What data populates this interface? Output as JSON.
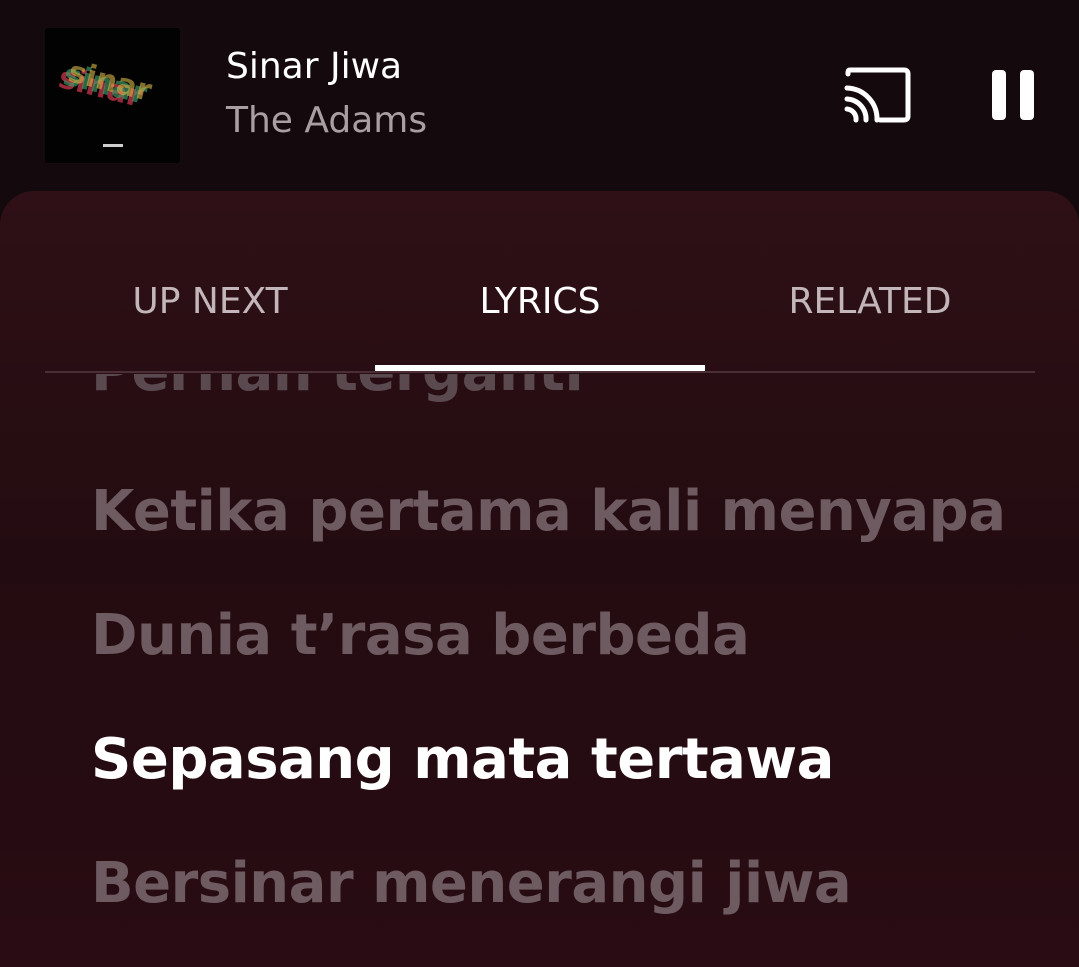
{
  "now_playing": {
    "title": "Sinar Jiwa",
    "artist": "The Adams"
  },
  "controls": {
    "cast_icon": "cast-icon",
    "pause_icon": "pause-icon"
  },
  "tabs": [
    {
      "label": "UP NEXT",
      "selected": false
    },
    {
      "label": "LYRICS",
      "selected": true
    },
    {
      "label": "RELATED",
      "selected": false
    }
  ],
  "lyrics": [
    {
      "text": "Pernah terganti",
      "active": false
    },
    {
      "text": "Ketika pertama kali menyapa",
      "active": false
    },
    {
      "text": "Dunia t’rasa berbeda",
      "active": false
    },
    {
      "text": "Sepasang mata tertawa",
      "active": true
    },
    {
      "text": "Bersinar menerangi jiwa",
      "active": false
    }
  ],
  "colors": {
    "background": "#140a0d",
    "sheet": "#2b0e14",
    "active_text": "#ffffff",
    "inactive_text": "#6e5a61"
  }
}
